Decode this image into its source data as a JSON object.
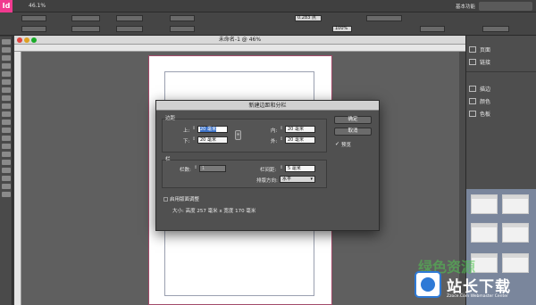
{
  "app": {
    "logo": "Id",
    "zoom": "46.1%",
    "workspace": "基本功能",
    "colors": {
      "accent": "#f03a8f",
      "selection": "#3d73c9",
      "watermark": "#2e7ad6"
    }
  },
  "controlbar": {
    "field_value": "0.283 点",
    "field_value2": "100%"
  },
  "document": {
    "title": "未命名-1 @ 46%"
  },
  "panels": {
    "items": [
      {
        "label": "页面",
        "icon": "pages-icon"
      },
      {
        "label": "链接",
        "icon": "links-icon"
      },
      {
        "label": "描边",
        "icon": "stroke-icon"
      },
      {
        "label": "颜色",
        "icon": "color-icon"
      },
      {
        "label": "色板",
        "icon": "swatches-icon"
      }
    ]
  },
  "dialog": {
    "title": "新建边距和分栏",
    "margins": {
      "group_label": "边距",
      "top_label": "上:",
      "top_value": "20 毫米",
      "bottom_label": "下:",
      "bottom_value": "20 毫米",
      "inside_label": "内:",
      "inside_value": "20 毫米",
      "outside_label": "外:",
      "outside_value": "20 毫米"
    },
    "columns": {
      "group_label": "栏",
      "count_label": "栏数:",
      "count_value": "1",
      "gutter_label": "栏间距:",
      "gutter_value": "5 毫米",
      "direction_label": "排版方向:",
      "direction_value": "水平"
    },
    "layout_adjust_label": "启用版面调整",
    "size_text": "大小: 高度 257 毫米 x 宽度 170 毫米",
    "ok_label": "确定",
    "cancel_label": "取消",
    "preview_label": "预览"
  },
  "watermark": {
    "brand": "站长下载",
    "sub": "Zzoce.Com Webmaster Center"
  }
}
